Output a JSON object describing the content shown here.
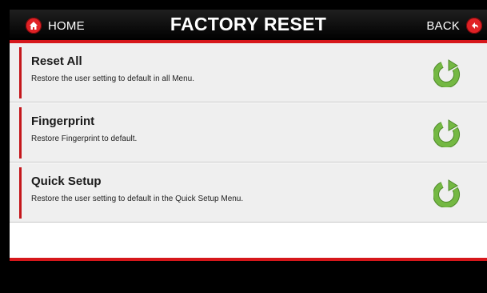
{
  "header": {
    "home_label": "HOME",
    "title": "FACTORY RESET",
    "back_label": "BACK"
  },
  "icons": {
    "home": "home-icon",
    "back": "back-arrow-icon",
    "reset": "reset-arrow-icon"
  },
  "colors": {
    "accent_red": "#d6171b",
    "icon_green": "#6db33f"
  },
  "items": [
    {
      "title": "Reset All",
      "description": "Restore the user setting to default in all Menu."
    },
    {
      "title": "Fingerprint",
      "description": "Restore Fingerprint to default."
    },
    {
      "title": "Quick Setup",
      "description": "Restore the user setting to default in the Quick Setup Menu."
    }
  ]
}
